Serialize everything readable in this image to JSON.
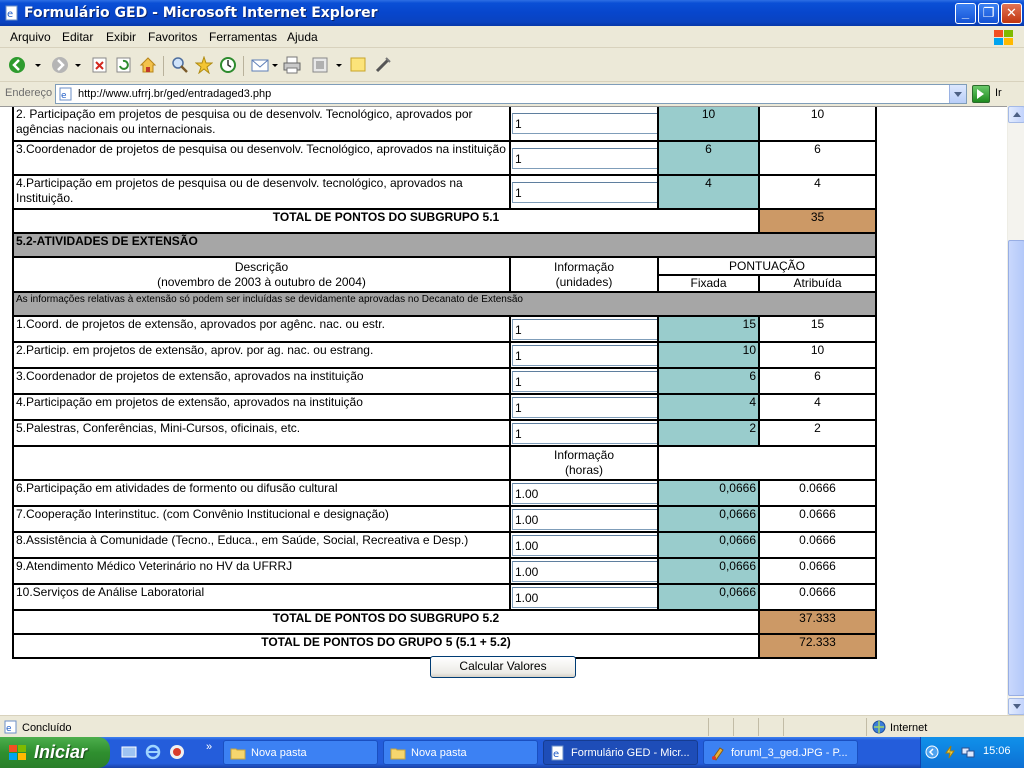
{
  "window": {
    "title": "Formulário GED - Microsoft Internet Explorer"
  },
  "menu": [
    "Arquivo",
    "Editar",
    "Exibir",
    "Favoritos",
    "Ferramentas",
    "Ajuda"
  ],
  "address": {
    "label": "Endereço",
    "url": "http://www.ufrrj.br/ged/entradaged3.php",
    "go_label": "Ir"
  },
  "form": {
    "subgroup51_rows": [
      {
        "desc": "2. Participação em projetos de pesquisa ou de desenvolv. Tecnológico, aprovados por agências nacionais ou internacionais.",
        "input": "1",
        "fixed": "10",
        "assigned": "10"
      },
      {
        "desc": "3.Coordenador de projetos de pesquisa ou desenvolv. Tecnológico, aprovados na instituição",
        "input": "1",
        "fixed": "6",
        "assigned": "6"
      },
      {
        "desc": "4.Participação em projetos de pesquisa ou de desenvolv. tecnológico, aprovados na Instituição.",
        "input": "1",
        "fixed": "4",
        "assigned": "4"
      }
    ],
    "total51": {
      "label": "TOTAL DE PONTOS DO SUBGRUPO 5.1",
      "value": "35"
    },
    "section52": "5.2-ATIVIDADES DE EXTENSÃO",
    "header": {
      "descricao": "Descrição",
      "periodo": "(novembro de 2003 à outubro de 2004)",
      "informacao": "Informação",
      "unidades": "(unidades)",
      "pontuacao": "PONTUAÇÃO",
      "fixada": "Fixada",
      "atribuida": "Atribuída"
    },
    "note": "As informações relativas à extensão só podem ser incluídas se devidamente aprovadas no Decanato de Extensão",
    "unit_rows": [
      {
        "desc": "1.Coord. de projetos de extensão, aprovados por agênc. nac. ou estr.",
        "input": "1",
        "fixed": "15",
        "assigned": "15"
      },
      {
        "desc": "2.Particip. em projetos de extensão, aprov. por ag. nac. ou estrang.",
        "input": "1",
        "fixed": "10",
        "assigned": "10"
      },
      {
        "desc": "3.Coordenador de projetos de extensão, aprovados na instituição",
        "input": "1",
        "fixed": "6",
        "assigned": "6"
      },
      {
        "desc": "4.Participação em projetos de extensão, aprovados na instituição",
        "input": "1",
        "fixed": "4",
        "assigned": "4"
      },
      {
        "desc": "5.Palestras, Conferências, Mini-Cursos, oficinais, etc.",
        "input": "1",
        "fixed": "2",
        "assigned": "2"
      }
    ],
    "hours_header": {
      "informacao": "Informação",
      "horas": "(horas)"
    },
    "hour_rows": [
      {
        "desc": "6.Participação em atividades de formento ou difusão cultural",
        "input": "1.00",
        "fixed": "0,0666",
        "assigned": "0.0666"
      },
      {
        "desc": "7.Cooperação Interinstituc. (com Convênio Institucional e designação)",
        "input": "1.00",
        "fixed": "0,0666",
        "assigned": "0.0666"
      },
      {
        "desc": "8.Assistência à Comunidade (Tecno., Educa., em Saúde, Social, Recreativa e Desp.)",
        "input": "1.00",
        "fixed": "0,0666",
        "assigned": "0.0666"
      },
      {
        "desc": "9.Atendimento Médico Veterinário no HV da UFRRJ",
        "input": "1.00",
        "fixed": "0,0666",
        "assigned": "0.0666"
      },
      {
        "desc": "10.Serviços de Análise Laboratorial",
        "input": "1.00",
        "fixed": "0,0666",
        "assigned": "0.0666"
      }
    ],
    "total52": {
      "label": "TOTAL DE PONTOS DO SUBGRUPO 5.2",
      "value": "37.333"
    },
    "total5": {
      "label": "TOTAL DE PONTOS DO GRUPO 5 (5.1 + 5.2)",
      "value": "72.333"
    },
    "calc_button": "Calcular Valores"
  },
  "status": {
    "text": "Concluído",
    "zone": "Internet"
  },
  "taskbar": {
    "start": "Iniciar",
    "tasks": [
      {
        "label": "Nova pasta",
        "icon": "folder-icon"
      },
      {
        "label": "Nova pasta",
        "icon": "folder-icon"
      },
      {
        "label": "Formulário GED - Micr...",
        "icon": "ie-icon"
      },
      {
        "label": "foruml_3_ged.JPG - P...",
        "icon": "paint-icon"
      }
    ],
    "clock": "15:06"
  },
  "colors": {
    "fixed_bg": "#99CCCC",
    "total_bg": "#CC9966",
    "section_bg": "#A6A6A6",
    "titlebar": "#0A4FD6"
  }
}
